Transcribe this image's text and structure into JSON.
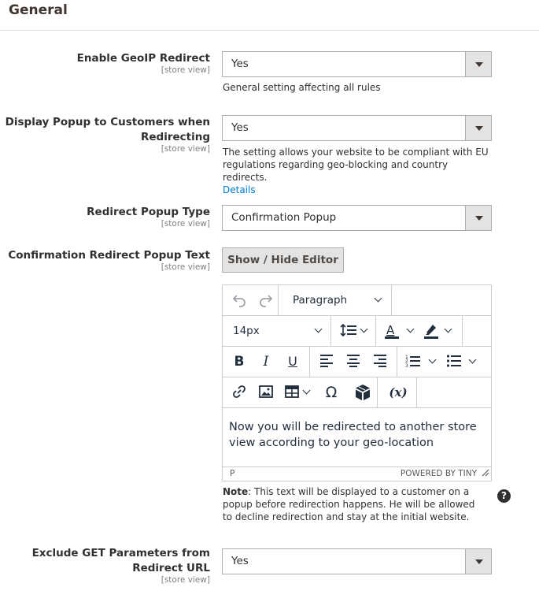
{
  "section": {
    "title": "General"
  },
  "scope_label": "[store view]",
  "fields": {
    "enable_geoip": {
      "label": "Enable GeoIP Redirect",
      "value": "Yes",
      "note": "General setting affecting all rules"
    },
    "display_popup": {
      "label_line1": "Display Popup to Customers when",
      "label_line2": "Redirecting",
      "value": "Yes",
      "note": "The setting allows your website to be compliant with EU regulations regarding geo-blocking and country redirects.",
      "note_link": "Details"
    },
    "popup_type": {
      "label": "Redirect Popup Type",
      "value": "Confirmation Popup"
    },
    "popup_text": {
      "label": "Confirmation Redirect Popup Text",
      "toggle_button": "Show / Hide Editor",
      "note_strong": "Note",
      "note_text": ": This text will be displayed to a customer on a popup before redirection happens. He will be allowed to decline redirection and stay at the initial website.",
      "help_icon": "?"
    },
    "exclude_get": {
      "label_line1": "Exclude GET Parameters from",
      "label_line2": "Redirect URL",
      "value": "Yes"
    }
  },
  "editor": {
    "block_format": "Paragraph",
    "font_size": "14px",
    "content": "Now you will be redirected to another store view according to your geo-location",
    "status_path": "P",
    "branding": "POWERED BY TINY",
    "toolbar_icons": [
      "undo-icon",
      "redo-icon",
      "line-height-icon",
      "text-color-icon",
      "highlight-color-icon",
      "bold-icon",
      "italic-icon",
      "underline-icon",
      "align-left-icon",
      "align-center-icon",
      "align-right-icon",
      "numbered-list-icon",
      "bullet-list-icon",
      "link-icon",
      "image-icon",
      "table-icon",
      "special-character-icon",
      "widget-icon",
      "variable-icon"
    ]
  }
}
